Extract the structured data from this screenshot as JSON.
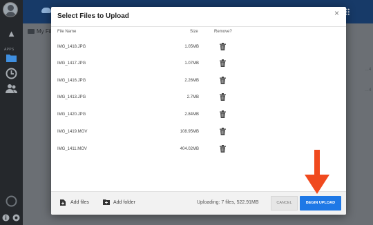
{
  "modal": {
    "title": "Select Files to Upload",
    "columns": {
      "file_name": "File Name",
      "size": "Size",
      "remove": "Remove?"
    },
    "files": [
      {
        "name": "IMG_1418.JPG",
        "size": "1.05MB"
      },
      {
        "name": "IMG_1417.JPG",
        "size": "1.07MB"
      },
      {
        "name": "IMG_1416.JPG",
        "size": "2.26MB"
      },
      {
        "name": "IMG_1413.JPG",
        "size": "2.7MB"
      },
      {
        "name": "IMG_1420.JPG",
        "size": "2.84MB"
      },
      {
        "name": "IMG_1419.MOV",
        "size": "108.95MB"
      },
      {
        "name": "IMG_1411.MOV",
        "size": "404.02MB"
      }
    ],
    "footer": {
      "add_files": "Add files",
      "add_folder": "Add folder",
      "status": "Uploading: 7 files, 522.91MB",
      "cancel": "CANCEL",
      "begin_upload": "BEGIN UPLOAD"
    }
  },
  "background": {
    "apps_label": "APPS",
    "breadcrumb": "My Fil"
  },
  "colors": {
    "accent_button": "#1e78e6",
    "annotation_arrow": "#f04a1e",
    "topbar": "#173a68"
  },
  "icons": [
    "close-icon",
    "trash-icon",
    "add-file-icon",
    "add-folder-icon",
    "grid-icon",
    "search-icon"
  ]
}
